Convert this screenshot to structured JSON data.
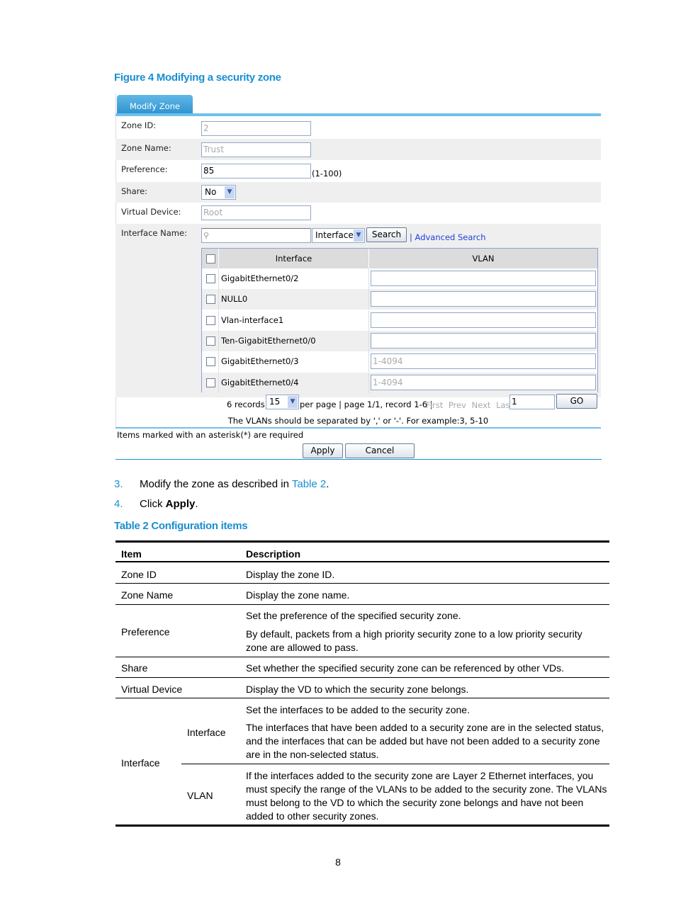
{
  "figure_caption": "Figure 4 Modifying a security zone",
  "form": {
    "tab": "Modify Zone",
    "fields": [
      {
        "label": "Zone ID:",
        "value": "2"
      },
      {
        "label": "Zone Name:",
        "value": "Trust"
      },
      {
        "label": "Preference:",
        "value": "85",
        "hint": "(1-100)"
      },
      {
        "label": "Share:",
        "value": "No"
      },
      {
        "label": "Virtual Device:",
        "value": "Root"
      },
      {
        "label": "Interface Name:",
        "value": ""
      }
    ],
    "search_field": "Interface",
    "search_button": "Search",
    "advanced_search": "| Advanced Search",
    "table": {
      "headers": [
        "Interface",
        "VLAN"
      ],
      "rows": [
        {
          "interface": "GigabitEthernet0/2",
          "vlan": ""
        },
        {
          "interface": "NULL0",
          "vlan": ""
        },
        {
          "interface": "Vlan-interface1",
          "vlan": ""
        },
        {
          "interface": "Ten-GigabitEthernet0/0",
          "vlan": ""
        },
        {
          "interface": "GigabitEthernet0/3",
          "vlan": "1-4094"
        },
        {
          "interface": "GigabitEthernet0/4",
          "vlan": "1-4094"
        }
      ]
    },
    "pagination": {
      "records": "6 records,",
      "per_page": "15",
      "info": "per page | page 1/1, record 1-6 |",
      "first": "First",
      "prev": "Prev",
      "next": "Next",
      "last": "Last",
      "page_input": "1",
      "go": "GO"
    },
    "vlan_note": "The VLANs should be separated by ',' or '-'. For example:3, 5-10",
    "required_note": "Items marked with an asterisk(*) are required",
    "apply": "Apply",
    "cancel": "Cancel"
  },
  "steps": [
    {
      "num": "3.",
      "pre": "Modify the zone as described in ",
      "link": "Table 2",
      "post": "."
    },
    {
      "num": "4.",
      "pre": "Click ",
      "bold": "Apply",
      "post": "."
    }
  ],
  "table_caption": "Table 2 Configuration items",
  "config_table": {
    "headers": [
      "Item",
      "Description"
    ],
    "zone_id": [
      "Zone ID",
      "Display the zone ID."
    ],
    "zone_name": [
      "Zone Name",
      "Display the zone name."
    ],
    "preference": [
      "Preference",
      "Set the preference of the specified security zone.",
      "By default, packets from a high priority security zone to a low priority security zone are allowed to pass."
    ],
    "share": [
      "Share",
      "Set whether the specified security zone can be referenced by other VDs."
    ],
    "vd": [
      "Virtual Device",
      "Display the VD to which the security zone belongs."
    ],
    "interface": "Interface",
    "iface_sub": [
      "Interface",
      "Set the interfaces to be added to the security zone.",
      "The interfaces that have been added to a security zone are in the selected status, and the interfaces that can be added but have not been added to a security zone are in the non-selected status."
    ],
    "vlan_sub": [
      "VLAN",
      "If the interfaces added to the security zone are Layer 2 Ethernet interfaces, you must specify the range of the VLANs to be added to the security zone. The VLANs must belong to the VD to which the security zone belongs and have not been added to other security zones."
    ]
  },
  "page_number": "8",
  "colors": {
    "accent": "#1a8fd0",
    "tab": "#3a9fd8",
    "link": "#1f3fdf"
  }
}
